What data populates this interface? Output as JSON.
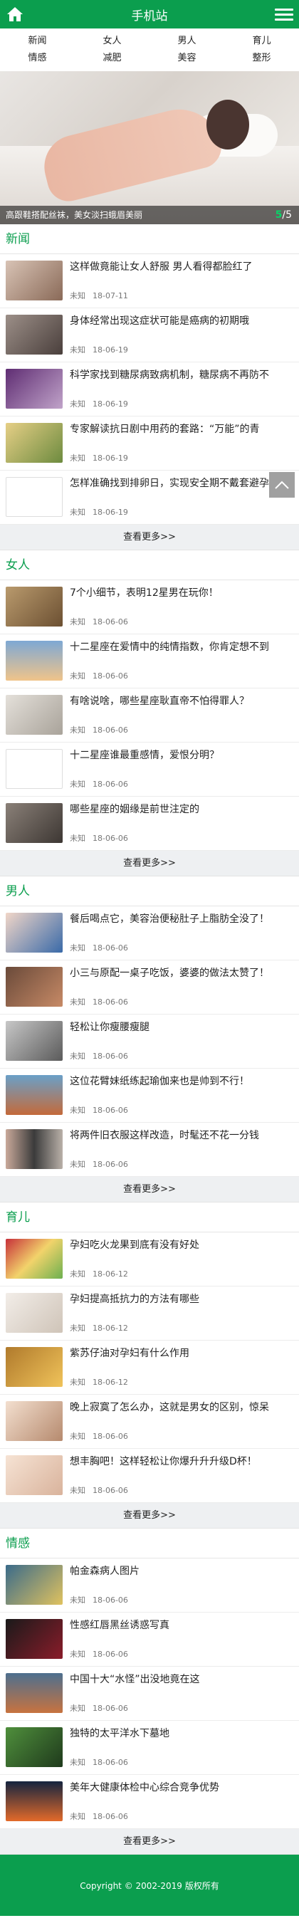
{
  "header": {
    "title": "手机站"
  },
  "nav": [
    "新闻",
    "女人",
    "男人",
    "育儿",
    "情感",
    "减肥",
    "美容",
    "整形"
  ],
  "banner": {
    "caption": "高跟鞋搭配丝袜，美女淡扫蛾眉美丽",
    "current": "5",
    "total": "/5"
  },
  "sections": [
    {
      "title": "新闻",
      "more": "查看更多>>",
      "items": [
        {
          "title": "这样做竟能让女人舒服 男人看得都脸红了",
          "source": "未知",
          "date": "18-07-11",
          "thumb": "g1"
        },
        {
          "title": "身体经常出现这症状可能是癌病的初期哦",
          "source": "未知",
          "date": "18-06-19",
          "thumb": "g2"
        },
        {
          "title": "科学家找到糖尿病致病机制，糖尿病不再防不",
          "source": "未知",
          "date": "18-06-19",
          "thumb": "g3"
        },
        {
          "title": "专家解读抗日剧中用药的套路：“万能”的青",
          "source": "未知",
          "date": "18-06-19",
          "thumb": "g4"
        },
        {
          "title": "怎样准确找到排卵日，实现安全期不戴套避孕",
          "source": "未知",
          "date": "18-06-19",
          "thumb": "g5"
        }
      ]
    },
    {
      "title": "女人",
      "more": "查看更多>>",
      "items": [
        {
          "title": "7个小细节，表明12星男在玩你！",
          "source": "未知",
          "date": "18-06-06",
          "thumb": "g6"
        },
        {
          "title": "十二星座在爱情中的纯情指数，你肯定想不到",
          "source": "未知",
          "date": "18-06-06",
          "thumb": "g7"
        },
        {
          "title": "有啥说啥，哪些星座耿直帝不怕得罪人？",
          "source": "未知",
          "date": "18-06-06",
          "thumb": "g8"
        },
        {
          "title": "十二星座谁最重感情，爱恨分明？",
          "source": "未知",
          "date": "18-06-06",
          "thumb": "g5"
        },
        {
          "title": "哪些星座的姻缘是前世注定的",
          "source": "未知",
          "date": "18-06-06",
          "thumb": "g9"
        }
      ]
    },
    {
      "title": "男人",
      "more": "查看更多>>",
      "items": [
        {
          "title": "餐后喝点它，美容治便秘肚子上脂肪全没了！",
          "source": "未知",
          "date": "18-06-06",
          "thumb": "g10"
        },
        {
          "title": "小三与原配一桌子吃饭，婆婆的做法太赞了！",
          "source": "未知",
          "date": "18-06-06",
          "thumb": "g11"
        },
        {
          "title": "轻松让你瘦腰瘦腿",
          "source": "未知",
          "date": "18-06-06",
          "thumb": "g12"
        },
        {
          "title": "这位花臂妹纸练起瑜伽来也是帅到不行！",
          "source": "未知",
          "date": "18-06-06",
          "thumb": "g13"
        },
        {
          "title": "将两件旧衣服这样改造，时髦还不花一分钱",
          "source": "未知",
          "date": "18-06-06",
          "thumb": "g14"
        }
      ]
    },
    {
      "title": "育儿",
      "more": "查看更多>>",
      "items": [
        {
          "title": "孕妇吃火龙果到底有没有好处",
          "source": "未知",
          "date": "18-06-12",
          "thumb": "g15"
        },
        {
          "title": "孕妇提高抵抗力的方法有哪些",
          "source": "未知",
          "date": "18-06-12",
          "thumb": "g16"
        },
        {
          "title": "紫苏仔油对孕妇有什么作用",
          "source": "未知",
          "date": "18-06-12",
          "thumb": "g17"
        },
        {
          "title": "晚上寂寞了怎么办，这就是男女的区别，惊呆",
          "source": "未知",
          "date": "18-06-06",
          "thumb": "g18"
        },
        {
          "title": "想丰胸吧！这样轻松让你爆升升升级D杯！",
          "source": "未知",
          "date": "18-06-06",
          "thumb": "g19"
        }
      ]
    },
    {
      "title": "情感",
      "more": "查看更多>>",
      "items": [
        {
          "title": "帕金森病人图片",
          "source": "未知",
          "date": "18-06-06",
          "thumb": "g20"
        },
        {
          "title": "性感红唇黑丝诱惑写真",
          "source": "未知",
          "date": "18-06-06",
          "thumb": "g21"
        },
        {
          "title": "中国十大“水怪”出没地竟在这",
          "source": "未知",
          "date": "18-06-06",
          "thumb": "g22"
        },
        {
          "title": "独特的太平洋水下墓地",
          "source": "未知",
          "date": "18-06-06",
          "thumb": "g23"
        },
        {
          "title": "美年大健康体检中心综合竞争优势",
          "source": "未知",
          "date": "18-06-06",
          "thumb": "g24"
        }
      ]
    }
  ],
  "footer": {
    "text": "Copyright © 2002-2019 版权所有"
  }
}
